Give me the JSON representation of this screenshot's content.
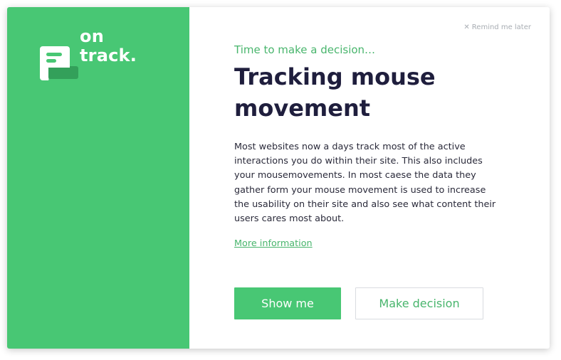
{
  "brand": {
    "line1": "on",
    "line2": "track.",
    "accent_color": "#48c774",
    "icon": "document-icon"
  },
  "header": {
    "remind_icon": "close-icon",
    "remind_glyph": "✕",
    "remind_label": "Remind me later"
  },
  "content": {
    "eyebrow": "Time to make a decision…",
    "title": "Tracking mouse movement",
    "body": "Most websites now a days track most of the active interactions you do within their site. This also includes your mousemovements. In most caese the data they gather form your mouse movement is used to increase the usability on their site and also see what content their users cares most about.",
    "more_link": "More information"
  },
  "actions": {
    "primary_label": "Show me",
    "secondary_label": "Make decision"
  }
}
